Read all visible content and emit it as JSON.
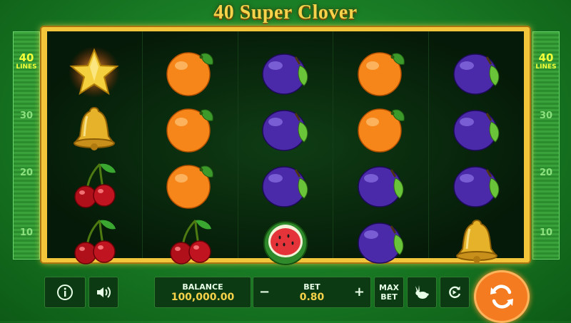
{
  "game_title": "40 Super Clover",
  "lines_label": {
    "number": "40",
    "text": "LINES"
  },
  "line_markers": [
    "30",
    "20",
    "10"
  ],
  "reels": [
    [
      "star",
      "bell",
      "cherry",
      "cherry"
    ],
    [
      "orange",
      "orange",
      "orange",
      "cherry"
    ],
    [
      "plum",
      "plum",
      "plum",
      "watermelon"
    ],
    [
      "orange",
      "orange",
      "plum",
      "plum"
    ],
    [
      "plum",
      "plum",
      "plum",
      "bell"
    ]
  ],
  "controls": {
    "info_icon": "info-icon",
    "sound_icon": "speaker-icon",
    "balance_label": "BALANCE",
    "balance_value": "100,000.00",
    "bet_label": "BET",
    "bet_value": "0.80",
    "bet_minus": "−",
    "bet_plus": "+",
    "maxbet_line1": "MAX",
    "maxbet_line2": "BET",
    "turbo_icon": "rabbit-icon",
    "autoplay_icon": "autoplay-icon",
    "spin_icon": "spin-icon"
  },
  "colors": {
    "accent": "#f47b20",
    "frame_gold": "#f2c53a",
    "line_yellow": "#f4ff3a"
  }
}
